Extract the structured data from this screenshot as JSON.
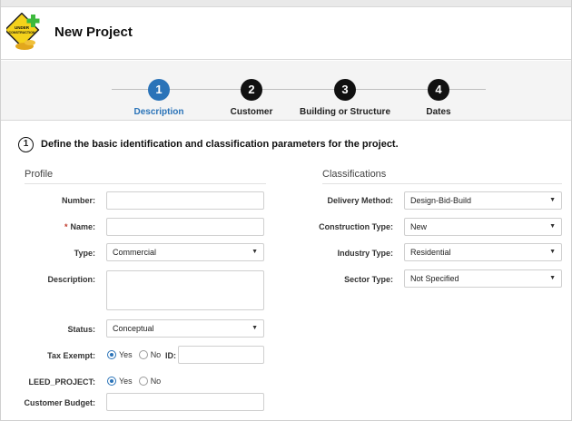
{
  "header": {
    "title": "New Project",
    "logo_icon": "under-construction-icon"
  },
  "steps": [
    {
      "number": "1",
      "label": "Description",
      "active": true
    },
    {
      "number": "2",
      "label": "Customer",
      "active": false
    },
    {
      "number": "3",
      "label": "Building or Structure",
      "active": false
    },
    {
      "number": "4",
      "label": "Dates",
      "active": false
    }
  ],
  "instruction": {
    "number": "1",
    "text": "Define the basic identification and classification parameters for the project."
  },
  "profile": {
    "heading": "Profile",
    "number_label": "Number:",
    "number_value": "",
    "name_required": "*",
    "name_label": "Name:",
    "name_value": "",
    "type_label": "Type:",
    "type_value": "Commercial",
    "description_label": "Description:",
    "description_value": "",
    "status_label": "Status:",
    "status_value": "Conceptual",
    "tax_exempt_label": "Tax Exempt:",
    "tax_exempt_yes": "Yes",
    "tax_exempt_no": "No",
    "tax_exempt_selected": "Yes",
    "id_label": "ID:",
    "id_value": "",
    "leed_label": "LEED_PROJECT:",
    "leed_yes": "Yes",
    "leed_no": "No",
    "leed_selected": "Yes",
    "budget_label": "Customer Budget:",
    "budget_value": ""
  },
  "classifications": {
    "heading": "Classifications",
    "delivery_label": "Delivery Method:",
    "delivery_value": "Design-Bid-Build",
    "construction_label": "Construction Type:",
    "construction_value": "New",
    "industry_label": "Industry Type:",
    "industry_value": "Residential",
    "sector_label": "Sector Type:",
    "sector_value": "Not Specified"
  },
  "colors": {
    "accent": "#2a73b8",
    "required": "#c0392b"
  }
}
